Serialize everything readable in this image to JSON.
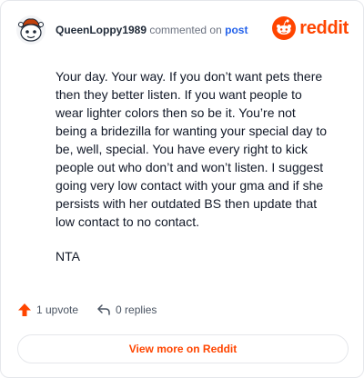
{
  "header": {
    "username": "QueenLoppy1989",
    "action_text": "commented on",
    "post_link": "post",
    "brand_word": "reddit"
  },
  "comment": {
    "paragraphs": [
      "Your day. Your way. If you don’t want pets there then they better listen. If you want people to wear lighter colors then so be it. You’re not being a bridezilla for wanting your special day to be, well, special. You have every right to kick people out who don’t and won’t listen. I suggest going very low contact with your gma and if she persists with her outdated BS then update that low contact to no contact.",
      "NTA"
    ]
  },
  "actions": {
    "upvote_label": "1 upvote",
    "replies_label": "0 replies"
  },
  "footer": {
    "view_more_label": "View more on Reddit"
  },
  "colors": {
    "brand": "#ff4500",
    "link": "#2563eb"
  },
  "icons": [
    "snoo-avatar-icon",
    "reddit-logo-icon",
    "upvote-arrow-icon",
    "reply-arrow-icon"
  ]
}
